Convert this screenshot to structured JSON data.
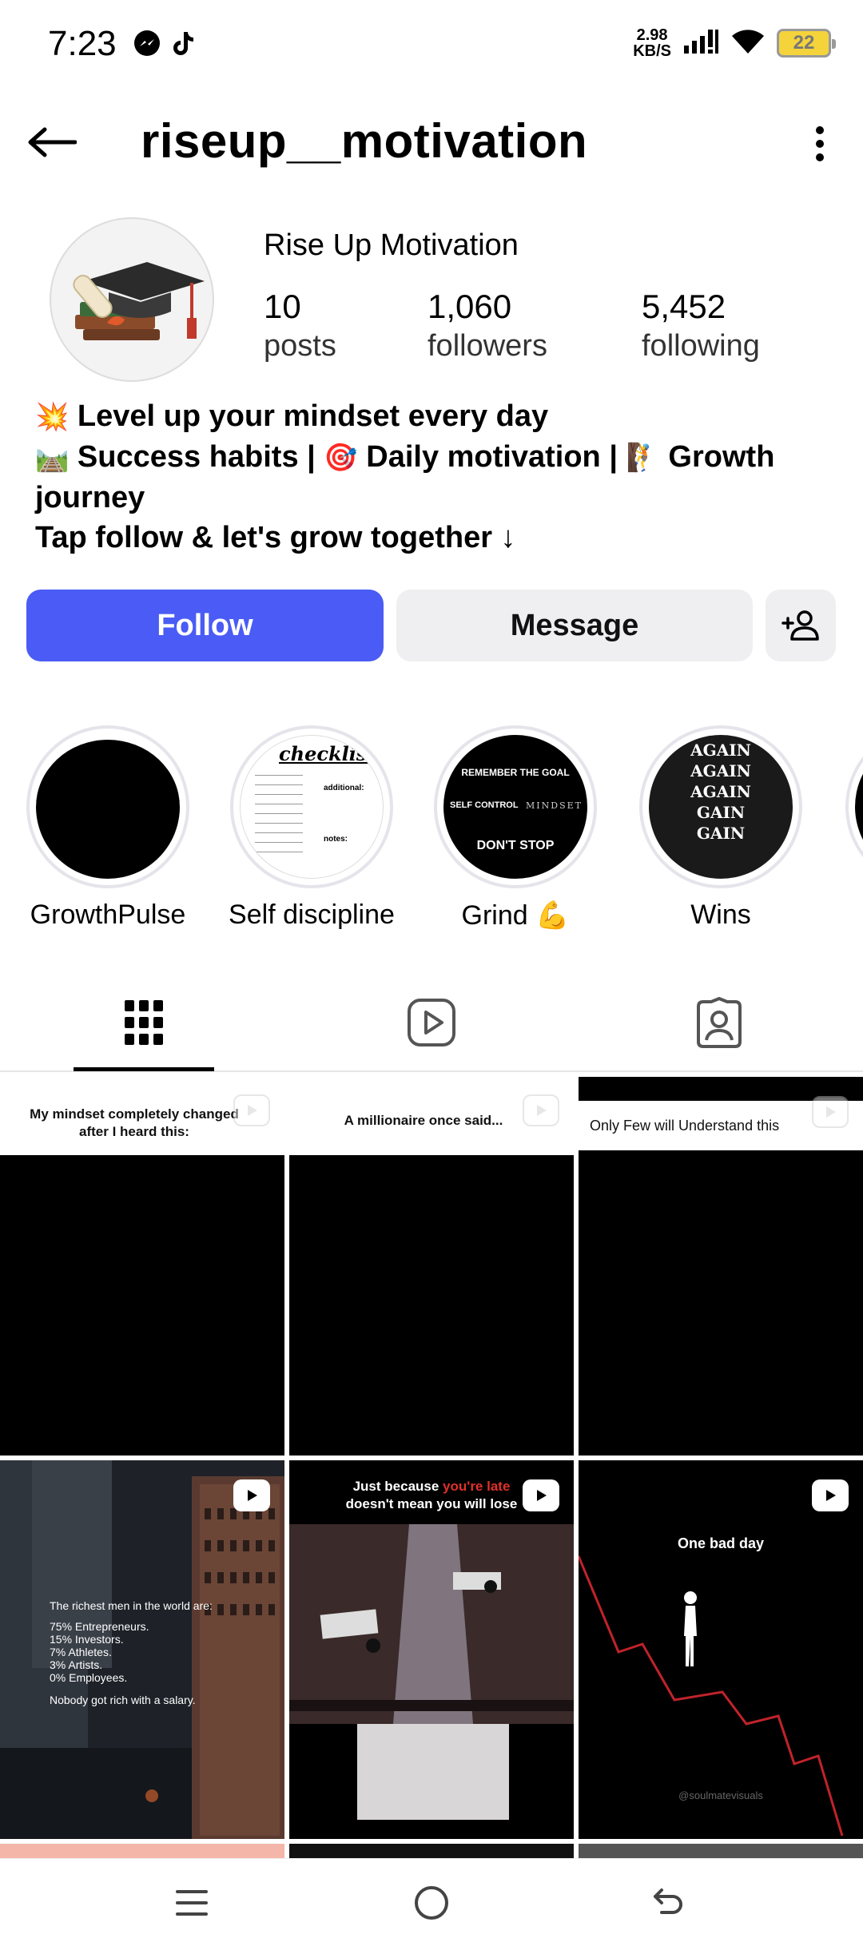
{
  "status_bar": {
    "time": "7:23",
    "net_speed_value": "2.98",
    "net_speed_unit": "KB/S",
    "battery": "22"
  },
  "header": {
    "username": "riseup__motivation"
  },
  "profile": {
    "display_name": "Rise Up Motivation",
    "stats": {
      "posts": {
        "count": "10",
        "label": "posts"
      },
      "followers": {
        "count": "1,060",
        "label": "followers"
      },
      "following": {
        "count": "5,452",
        "label": "following"
      }
    },
    "bio": {
      "line1": "Level up your mindset every day",
      "line2a": "Success habits |",
      "line2b": "Daily motivation |",
      "line2c": "Growth journey",
      "line3": "Tap follow & let's grow together ↓"
    }
  },
  "actions": {
    "follow": "Follow",
    "message": "Message"
  },
  "highlights": [
    {
      "label": "GrowthPulse"
    },
    {
      "label": "Self discipline",
      "cover_title": "checklist",
      "cover_additional": "additional:",
      "cover_notes": "notes:"
    },
    {
      "label": "Grind 💪",
      "cover_top": "REMEMBER THE GOAL",
      "cover_mid_left": "SELF CONTROL",
      "cover_mid_right": "MINDSET",
      "cover_bottom": "DON'T STOP"
    },
    {
      "label": "Wins",
      "cover_lines": [
        "AGAIN",
        "AGAIN",
        "AGAIN",
        "GAIN",
        "GAIN"
      ]
    }
  ],
  "posts": [
    {
      "caption": "My mindset completely changed after I heard this:"
    },
    {
      "caption": "A millionaire once said..."
    },
    {
      "caption": "Only Few will Understand this"
    },
    {
      "overlay_title": "The richest men in the world are:",
      "overlay_lines": [
        "75% Entrepreneurs.",
        "15% Investors.",
        "7% Athletes.",
        "3% Artists.",
        "0% Employees."
      ],
      "overlay_footer": "Nobody got rich with a salary."
    },
    {
      "overlay_line1_a": "Just because ",
      "overlay_line1_b": "you're late",
      "overlay_line2": "doesn't mean you will lose"
    },
    {
      "overlay_title": "One bad day",
      "watermark": "@soulmatevisuals"
    }
  ]
}
